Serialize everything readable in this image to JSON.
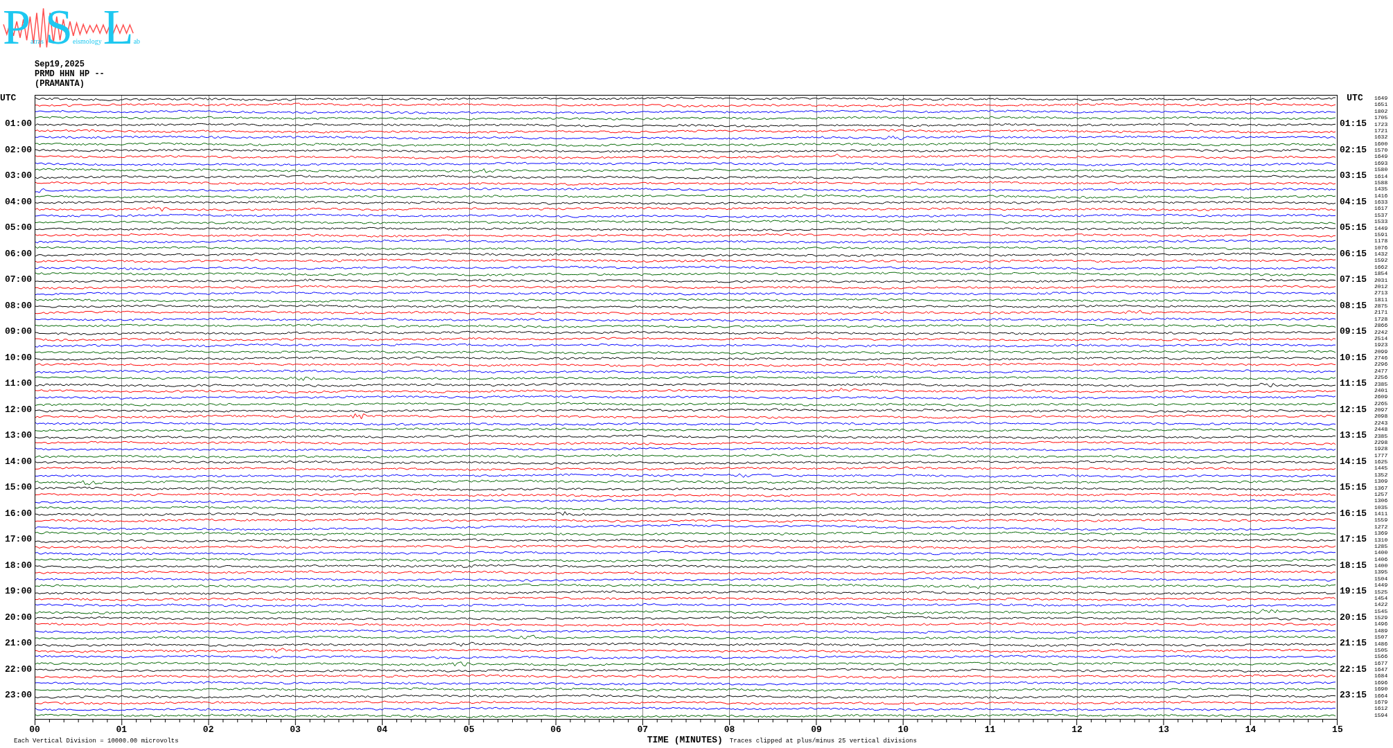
{
  "logo": {
    "letters": [
      {
        "initial": "P",
        "rest": "atras"
      },
      {
        "initial": "S",
        "rest": "eismology"
      },
      {
        "initial": "L",
        "rest": "ab"
      }
    ]
  },
  "header": {
    "date": "Sep19,2025",
    "station": "PRMD HHN HP --",
    "site": "(PRAMANTA)"
  },
  "left_axis": {
    "title": "UTC",
    "labels": [
      "01:00",
      "02:00",
      "03:00",
      "04:00",
      "05:00",
      "06:00",
      "07:00",
      "08:00",
      "09:00",
      "10:00",
      "11:00",
      "12:00",
      "13:00",
      "14:00",
      "15:00",
      "16:00",
      "17:00",
      "18:00",
      "19:00",
      "20:00",
      "21:00",
      "22:00",
      "23:00"
    ]
  },
  "right_axis": {
    "title": "UTC",
    "labels": [
      "01:15",
      "02:15",
      "03:15",
      "04:15",
      "05:15",
      "06:15",
      "07:15",
      "08:15",
      "09:15",
      "10:15",
      "11:15",
      "12:15",
      "13:15",
      "14:15",
      "15:15",
      "16:15",
      "17:15",
      "18:15",
      "19:15",
      "20:15",
      "21:15",
      "22:15",
      "23:15"
    ]
  },
  "traces": [
    {
      "color": "#000000",
      "value": "1649"
    },
    {
      "color": "#ff0000",
      "value": "1651"
    },
    {
      "color": "#0000ff",
      "value": "1802"
    },
    {
      "color": "#006400",
      "value": "1705"
    },
    {
      "color": "#000000",
      "value": "1723"
    },
    {
      "color": "#ff0000",
      "value": "1721"
    },
    {
      "color": "#0000ff",
      "value": "1632"
    },
    {
      "color": "#006400",
      "value": "1600"
    },
    {
      "color": "#000000",
      "value": "1570"
    },
    {
      "color": "#ff0000",
      "value": "1649"
    },
    {
      "color": "#0000ff",
      "value": "1693"
    },
    {
      "color": "#006400",
      "value": "1580"
    },
    {
      "color": "#000000",
      "value": "1614"
    },
    {
      "color": "#ff0000",
      "value": "1588"
    },
    {
      "color": "#0000ff",
      "value": "1435"
    },
    {
      "color": "#006400",
      "value": "1416"
    },
    {
      "color": "#000000",
      "value": "1633"
    },
    {
      "color": "#ff0000",
      "value": "1617"
    },
    {
      "color": "#0000ff",
      "value": "1537"
    },
    {
      "color": "#006400",
      "value": "1533"
    },
    {
      "color": "#000000",
      "value": "1449"
    },
    {
      "color": "#ff0000",
      "value": "1591"
    },
    {
      "color": "#0000ff",
      "value": "1178"
    },
    {
      "color": "#006400",
      "value": "1076"
    },
    {
      "color": "#000000",
      "value": "1432"
    },
    {
      "color": "#ff0000",
      "value": "1592"
    },
    {
      "color": "#0000ff",
      "value": "1662"
    },
    {
      "color": "#006400",
      "value": "1854"
    },
    {
      "color": "#000000",
      "value": "2031"
    },
    {
      "color": "#ff0000",
      "value": "2012"
    },
    {
      "color": "#0000ff",
      "value": "2713"
    },
    {
      "color": "#006400",
      "value": "1811"
    },
    {
      "color": "#000000",
      "value": "2875"
    },
    {
      "color": "#ff0000",
      "value": "2171"
    },
    {
      "color": "#0000ff",
      "value": "1728"
    },
    {
      "color": "#006400",
      "value": "2866"
    },
    {
      "color": "#000000",
      "value": "2242"
    },
    {
      "color": "#ff0000",
      "value": "2514"
    },
    {
      "color": "#0000ff",
      "value": "1923"
    },
    {
      "color": "#006400",
      "value": "2099"
    },
    {
      "color": "#000000",
      "value": "2746"
    },
    {
      "color": "#ff0000",
      "value": "2296"
    },
    {
      "color": "#0000ff",
      "value": "2477"
    },
    {
      "color": "#006400",
      "value": "2256"
    },
    {
      "color": "#000000",
      "value": "2385"
    },
    {
      "color": "#ff0000",
      "value": "2401"
    },
    {
      "color": "#0000ff",
      "value": "2609"
    },
    {
      "color": "#006400",
      "value": "2265"
    },
    {
      "color": "#000000",
      "value": "2097"
    },
    {
      "color": "#ff0000",
      "value": "2098"
    },
    {
      "color": "#0000ff",
      "value": "2243"
    },
    {
      "color": "#006400",
      "value": "2448"
    },
    {
      "color": "#000000",
      "value": "2385"
    },
    {
      "color": "#ff0000",
      "value": "2298"
    },
    {
      "color": "#0000ff",
      "value": "1928"
    },
    {
      "color": "#006400",
      "value": "1777"
    },
    {
      "color": "#000000",
      "value": "1625"
    },
    {
      "color": "#ff0000",
      "value": "1445"
    },
    {
      "color": "#0000ff",
      "value": "1352"
    },
    {
      "color": "#006400",
      "value": "1309"
    },
    {
      "color": "#000000",
      "value": "1367"
    },
    {
      "color": "#ff0000",
      "value": "1257"
    },
    {
      "color": "#0000ff",
      "value": "1306"
    },
    {
      "color": "#006400",
      "value": "1035"
    },
    {
      "color": "#000000",
      "value": "1411"
    },
    {
      "color": "#ff0000",
      "value": "1559"
    },
    {
      "color": "#0000ff",
      "value": "1272"
    },
    {
      "color": "#006400",
      "value": "1369"
    },
    {
      "color": "#000000",
      "value": "1310"
    },
    {
      "color": "#ff0000",
      "value": "1285"
    },
    {
      "color": "#0000ff",
      "value": "1400"
    },
    {
      "color": "#006400",
      "value": "1406"
    },
    {
      "color": "#000000",
      "value": "1400"
    },
    {
      "color": "#ff0000",
      "value": "1395"
    },
    {
      "color": "#0000ff",
      "value": "1504"
    },
    {
      "color": "#006400",
      "value": "1449"
    },
    {
      "color": "#000000",
      "value": "1525"
    },
    {
      "color": "#ff0000",
      "value": "1454"
    },
    {
      "color": "#0000ff",
      "value": "1422"
    },
    {
      "color": "#006400",
      "value": "1545"
    },
    {
      "color": "#000000",
      "value": "1529"
    },
    {
      "color": "#ff0000",
      "value": "1496"
    },
    {
      "color": "#0000ff",
      "value": "1489"
    },
    {
      "color": "#006400",
      "value": "1507"
    },
    {
      "color": "#000000",
      "value": "1486"
    },
    {
      "color": "#ff0000",
      "value": "1505"
    },
    {
      "color": "#0000ff",
      "value": "1566"
    },
    {
      "color": "#006400",
      "value": "1677"
    },
    {
      "color": "#000000",
      "value": "1647"
    },
    {
      "color": "#ff0000",
      "value": "1684"
    },
    {
      "color": "#0000ff",
      "value": "1696"
    },
    {
      "color": "#006400",
      "value": "1690"
    },
    {
      "color": "#000000",
      "value": "1664"
    },
    {
      "color": "#ff0000",
      "value": "1679"
    },
    {
      "color": "#0000ff",
      "value": "1612"
    },
    {
      "color": "#006400",
      "value": "1594"
    }
  ],
  "x_axis": {
    "ticks": [
      "00",
      "01",
      "02",
      "03",
      "04",
      "05",
      "06",
      "07",
      "08",
      "09",
      "10",
      "11",
      "12",
      "13",
      "14",
      "15"
    ],
    "title": "TIME (MINUTES)"
  },
  "footer": {
    "scale_note": "Each Vertical Division = 10000.00 microvolts",
    "clip_note": "Traces clipped at plus/minus 25 vertical divisions"
  }
}
